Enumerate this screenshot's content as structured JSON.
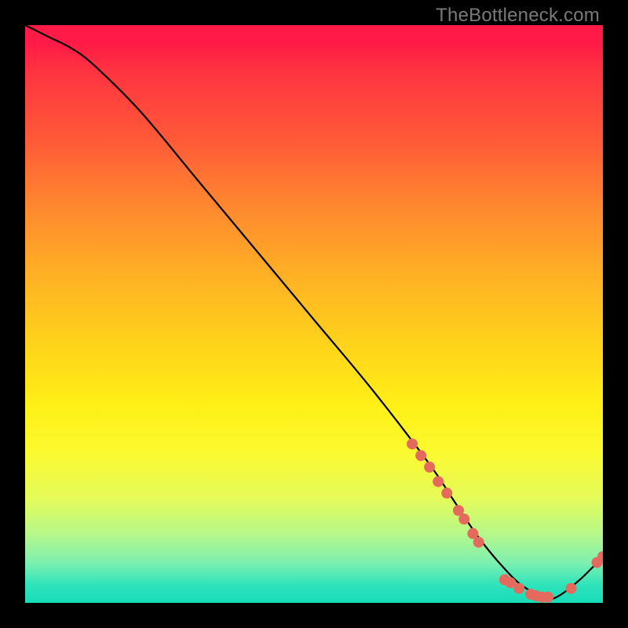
{
  "watermark": {
    "text": "TheBottleneck.com"
  },
  "chart_data": {
    "type": "line",
    "title": "",
    "xlabel": "",
    "ylabel": "",
    "xlim": [
      0,
      100
    ],
    "ylim": [
      0,
      100
    ],
    "grid": false,
    "series": [
      {
        "name": "curve",
        "color": "#000000",
        "x": [
          0,
          4,
          8,
          12,
          20,
          30,
          40,
          50,
          60,
          70,
          74,
          78,
          82,
          86,
          90,
          92,
          96,
          100
        ],
        "y": [
          100,
          98,
          96,
          93,
          85,
          73,
          61,
          49,
          37,
          24,
          18,
          12,
          7,
          3,
          1,
          1,
          4,
          8
        ]
      }
    ],
    "markers": {
      "name": "dots",
      "color": "#e46a5e",
      "radius_px": 7,
      "points": [
        {
          "x": 67.0,
          "y": 27.5
        },
        {
          "x": 68.5,
          "y": 25.5
        },
        {
          "x": 70.0,
          "y": 23.5
        },
        {
          "x": 71.5,
          "y": 21.0
        },
        {
          "x": 73.0,
          "y": 19.0
        },
        {
          "x": 75.0,
          "y": 16.0
        },
        {
          "x": 76.0,
          "y": 14.5
        },
        {
          "x": 77.5,
          "y": 12.0
        },
        {
          "x": 78.5,
          "y": 10.5
        },
        {
          "x": 83.0,
          "y": 4.0
        },
        {
          "x": 84.0,
          "y": 3.5
        },
        {
          "x": 85.5,
          "y": 2.5
        },
        {
          "x": 87.5,
          "y": 1.5
        },
        {
          "x": 88.5,
          "y": 1.2
        },
        {
          "x": 89.5,
          "y": 1.0
        },
        {
          "x": 90.5,
          "y": 1.0
        },
        {
          "x": 94.5,
          "y": 2.5
        },
        {
          "x": 99.0,
          "y": 7.0
        },
        {
          "x": 100.0,
          "y": 8.0
        }
      ]
    }
  }
}
